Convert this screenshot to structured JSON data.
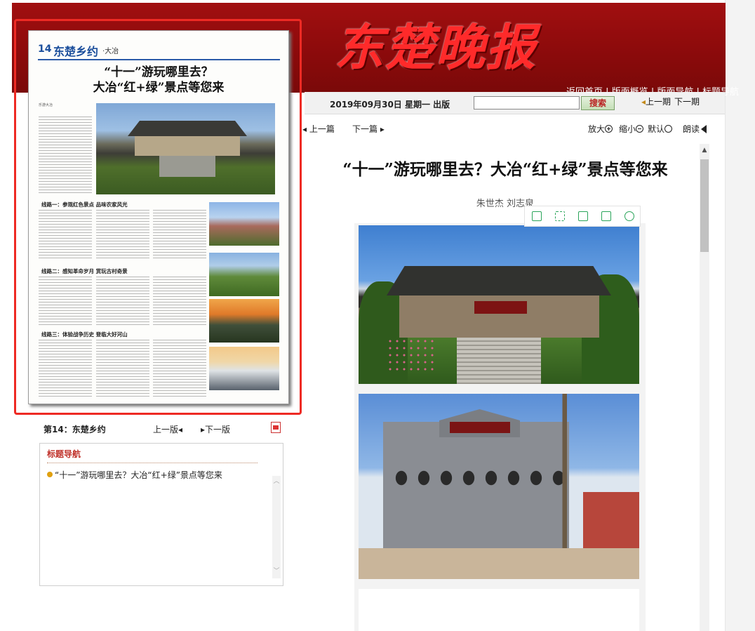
{
  "masthead": {
    "logo_text": "东楚晚报",
    "nav_links": [
      "返回首页",
      "版面概览",
      "版面导航",
      "标题导航"
    ],
    "nav_separator": " | "
  },
  "date_bar": {
    "date": "2019年09月30日 星期一 出版",
    "search_placeholder": "",
    "search_button": "搜索",
    "prev_issue": "上一期",
    "next_issue": "下一期"
  },
  "page_thumbnail": {
    "page_number": "14",
    "section_name": "东楚乡约",
    "region": "·大冶",
    "headline_line1": "“十一”游玩哪里去？",
    "headline_line2": "大冶“红+绿”景点等您来",
    "route1": "线路一：参观红色景点  品味农家风光",
    "route2": "线路二：感知革命岁月  赏玩古村奇景",
    "route3": "线路三：体验战争历史  登临大好河山",
    "badge": "乐游大冶"
  },
  "page_nav": {
    "edition_label": "第14：东楚乡约",
    "prev_page": "上一版",
    "next_page": "下一版"
  },
  "headline_nav": {
    "title": "标题导航",
    "items": [
      "“十一”游玩哪里去？大冶“红+绿”景点等您来"
    ]
  },
  "article_nav": {
    "prev_article": "上一篇",
    "next_article": "下一篇",
    "zoom_in": "放大",
    "zoom_out": "缩小",
    "zoom_default": "默认",
    "read_aloud": "朗读"
  },
  "article": {
    "title": "“十一”游玩哪里去？大冶“红+绿”景点等您来",
    "author": "朱世杰 刘志泉"
  },
  "colors": {
    "masthead_red": "#8a0a0b",
    "accent_red": "#c0322b",
    "highlight_border": "#ee2a24",
    "toolbar_green": "#2aa45a"
  },
  "icons": {
    "image_toolbar": [
      "single-page-icon",
      "fullscreen-icon",
      "save-icon",
      "share-icon",
      "settings-icon"
    ]
  }
}
